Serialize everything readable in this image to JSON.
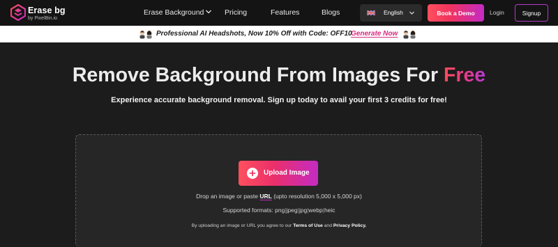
{
  "nav": {
    "brand_name": "Erase bg",
    "brand_sub": "by PixelBin.io",
    "links": [
      "Erase Background",
      "Pricing",
      "Features",
      "Blogs"
    ],
    "language": "English",
    "book_demo": "Book a Demo",
    "login": "Login",
    "signup": "Signup"
  },
  "promo": {
    "text": "Professional AI Headshots, Now 10% Off with Code: OFF10",
    "link": "Generate Now"
  },
  "hero": {
    "title_main": "Remove Background From Images For ",
    "title_accent": "Free",
    "subtitle": "Experience accurate background removal. Sign up today to avail your first 3 credits for free!"
  },
  "upload": {
    "button_label": "Upload Image",
    "drop_prefix": "Drop an image or paste ",
    "drop_link": "URL",
    "drop_suffix": " (upto resolution 5,000 x 5,000 px)",
    "formats_label": "Supported formats:",
    "formats": [
      "png",
      "jpeg",
      "jpg",
      "webp",
      "heic"
    ],
    "terms_prefix": "By uploading an image or URL you agree to our ",
    "terms_link": "Terms of Use",
    "terms_and": " and ",
    "privacy_link": "Privacy Policy."
  },
  "icons": {
    "logo": "erase-bg-logo",
    "nav_dropdown": "chevron-down-icon",
    "flag": "uk-flag-icon",
    "promo_decoration": "people-emoji-icon",
    "upload": "plus-icon"
  },
  "colors": {
    "accent_pink": "#ff4f5e",
    "accent_purple": "#c42bc4",
    "link_pink": "#d8297e",
    "background": "#1c1c1c"
  }
}
